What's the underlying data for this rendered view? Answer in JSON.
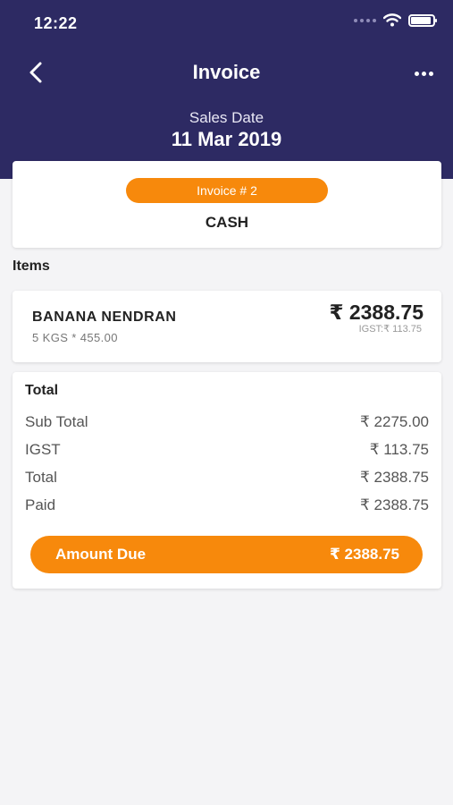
{
  "status_bar": {
    "time": "12:22"
  },
  "header": {
    "title": "Invoice",
    "sales_date_label": "Sales Date",
    "sales_date": "11 Mar 2019"
  },
  "invoice": {
    "number_label": "Invoice # 2",
    "payment_mode": "CASH"
  },
  "items": {
    "label": "Items",
    "list": [
      {
        "name": "BANANA NENDRAN",
        "quantity": "5 KGS * 455.00",
        "amount": "₹ 2388.75",
        "tax": "IGST:₹ 113.75"
      }
    ]
  },
  "totals": {
    "title": "Total",
    "rows": [
      {
        "label": "Sub Total",
        "value": "₹ 2275.00"
      },
      {
        "label": "IGST",
        "value": "₹ 113.75"
      },
      {
        "label": "Total",
        "value": "₹ 2388.75"
      },
      {
        "label": "Paid",
        "value": "₹ 2388.75"
      }
    ],
    "amount_due_label": "Amount Due",
    "amount_due_value": "₹ 2388.75"
  },
  "colors": {
    "header": "#2d2a63",
    "accent": "#f7890c",
    "background": "#f4f4f6"
  },
  "icons": [
    "chevron-left-icon",
    "more-horizontal-icon",
    "wifi-icon",
    "battery-icon",
    "signal-icon"
  ]
}
